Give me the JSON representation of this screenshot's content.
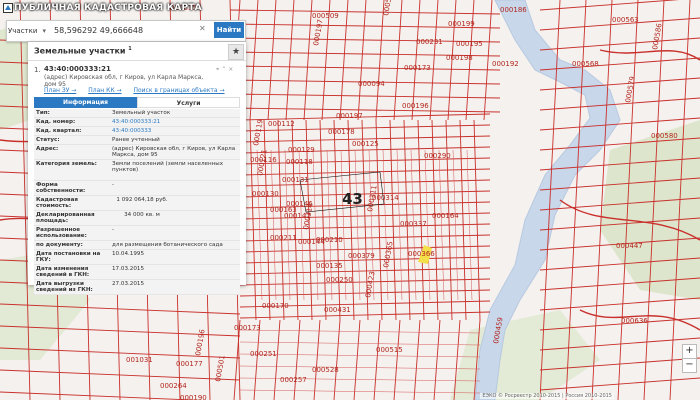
{
  "app": {
    "title": "ПУБЛИЧНАЯ КАДАСТРОВАЯ КАРТА"
  },
  "search": {
    "type": "Участки",
    "value": "58,596292 49,666648",
    "button": "Найти"
  },
  "panel": {
    "title": "Земельные участки",
    "title_count": "1",
    "result": {
      "num": "1.",
      "cad_id": "43:40:000333:21",
      "address": "(адрес) Кировская обл, г Киров, ул Карла Маркса, дом 95"
    },
    "links": [
      "План ЗУ →",
      "План КК →",
      "Поиск в границах объекта →"
    ],
    "tabs": [
      "Информация",
      "Услуги"
    ],
    "properties": [
      {
        "k": "Тип:",
        "v": "Земельный участок"
      },
      {
        "k": "Кад. номер:",
        "v": "43:40:000333:21",
        "link": true
      },
      {
        "k": "Кад. квартал:",
        "v": "43:40:000333",
        "link": true
      },
      {
        "k": "Статус:",
        "v": "Ранее учтенный"
      },
      {
        "k": "Адрес:",
        "v": "(адрес) Кировская обл, г Киров, ул Карла Маркса, дом 95"
      },
      {
        "k": "Категория земель:",
        "v": "Земли поселений (земли населенных пунктов)"
      },
      {
        "k": "Форма собственности:",
        "v": "-"
      },
      {
        "k": "Кадастровая стоимость:",
        "v": "1 092 064,18 руб."
      },
      {
        "k": "Декларированная площадь:",
        "v": "34 000 кв. м"
      },
      {
        "k": "Разрешенное использование:",
        "v": "-"
      },
      {
        "k": "по документу:",
        "v": "для размещения ботанического сада"
      },
      {
        "k": "Дата постановки на ГКУ:",
        "v": "10.04.1995"
      },
      {
        "k": "Дата изменения сведений в ГКН:",
        "v": "17.03.2015"
      },
      {
        "k": "Дата выгрузки сведений из ГКН:",
        "v": "27.03.2015"
      }
    ]
  },
  "map": {
    "quarter_label": "43",
    "parcel_labels": [
      "000815",
      "000509",
      "000509",
      "000563",
      "000199",
      "000186",
      "000231",
      "000197",
      "000195",
      "000198",
      "000094",
      "000173",
      "000586",
      "000568",
      "000192",
      "000196",
      "000197",
      "000579",
      "000580",
      "000112",
      "000129",
      "000178",
      "000119",
      "000125",
      "000290",
      "000116",
      "000118",
      "000121",
      "000211",
      "000210",
      "000131",
      "000314",
      "000311",
      "000130",
      "000164",
      "000146",
      "000142",
      "000314",
      "000163",
      "000144",
      "000379",
      "000135",
      "000365",
      "000366",
      "000337",
      "000447",
      "000250",
      "000423",
      "000170",
      "000431",
      "000173",
      "000515",
      "000459",
      "000636",
      "001031",
      "000177",
      "000251",
      "000501",
      "000528",
      "000264",
      "000257",
      "000190",
      "000196"
    ],
    "attribution": "ЕЭКО © Росреестр 2010-2015 | Россия 2010-2015"
  },
  "zoom": {
    "in": "+",
    "out": "−"
  }
}
